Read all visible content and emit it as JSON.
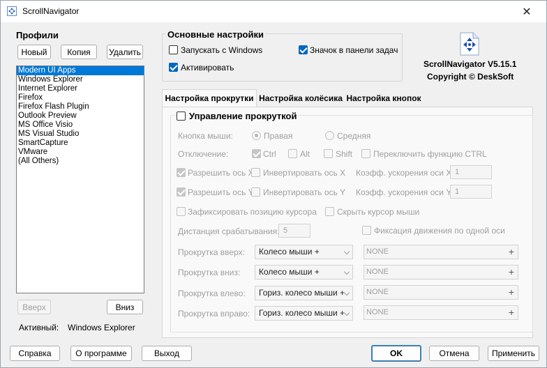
{
  "window": {
    "title": "ScrollNavigator",
    "close_glyph": "✕"
  },
  "profiles": {
    "title": "Профили",
    "new_label": "Новый",
    "copy_label": "Копия",
    "delete_label": "Удалить",
    "items": [
      "Modern UI Apps",
      "Windows Explorer",
      "Internet Explorer",
      "Firefox",
      "Firefox Flash Plugin",
      "Outlook Preview",
      "MS Office Visio",
      "MS Visual Studio",
      "SmartCapture",
      "VMware",
      "(All Others)"
    ],
    "up_label": "Вверх",
    "down_label": "Вниз",
    "active_label": "Активный:",
    "active_value": "Windows Explorer"
  },
  "basic": {
    "title": "Основные настройки",
    "startup_label": "Запускать с Windows",
    "tray_label": "Значок в панели задач",
    "activate_label": "Активировать"
  },
  "about": {
    "version": "ScrollNavigator V5.15.1",
    "copyright": "Copyright © DeskSoft"
  },
  "tabs": [
    "Настройка прокрутки",
    "Настройка колёсика",
    "Настройка кнопок"
  ],
  "scroll": {
    "control_label": "Управление прокруткой",
    "mouse_button_label": "Кнопка мыши:",
    "right_label": "Правая",
    "middle_label": "Средняя",
    "disable_label": "Отключение:",
    "ctrl_label": "Ctrl",
    "alt_label": "Alt",
    "shift_label": "Shift",
    "toggle_ctrl_label": "Переключить функцию CTRL",
    "allow_x_label": "Разрешить ось X",
    "invert_x_label": "Инвертировать ось X",
    "accel_x_label": "Коэфф. ускорения оси X",
    "accel_x_value": "1",
    "allow_y_label": "Разрешить ось Y",
    "invert_y_label": "Инвертировать ось Y",
    "accel_y_label": "Коэфф. ускорения оси Y",
    "accel_y_value": "1",
    "fix_cursor_label": "Зафиксировать позицию курсора",
    "hide_cursor_label": "Скрыть курсор мыши",
    "distance_label": "Дистанция срабатывания:",
    "distance_value": "5",
    "single_axis_label": "Фиксация движения по одной оси",
    "rows": [
      {
        "label": "Прокрутка вверх:",
        "combo": "Колесо мыши +",
        "hotkey": "NONE"
      },
      {
        "label": "Прокрутка вниз:",
        "combo": "Колесо мыши +",
        "hotkey": "NONE"
      },
      {
        "label": "Прокрутка влево:",
        "combo": "Гориз. колесо мыши +",
        "hotkey": "NONE"
      },
      {
        "label": "Прокрутка вправо:",
        "combo": "Гориз. колесо мыши +",
        "hotkey": "NONE"
      }
    ],
    "plus_glyph": "+"
  },
  "footer": {
    "help_label": "Справка",
    "about_label": "О программе",
    "exit_label": "Выход",
    "ok_label": "OK",
    "cancel_label": "Отмена",
    "apply_label": "Применить"
  },
  "colors": {
    "accent": "#0078d7",
    "check": "#0067c0"
  }
}
